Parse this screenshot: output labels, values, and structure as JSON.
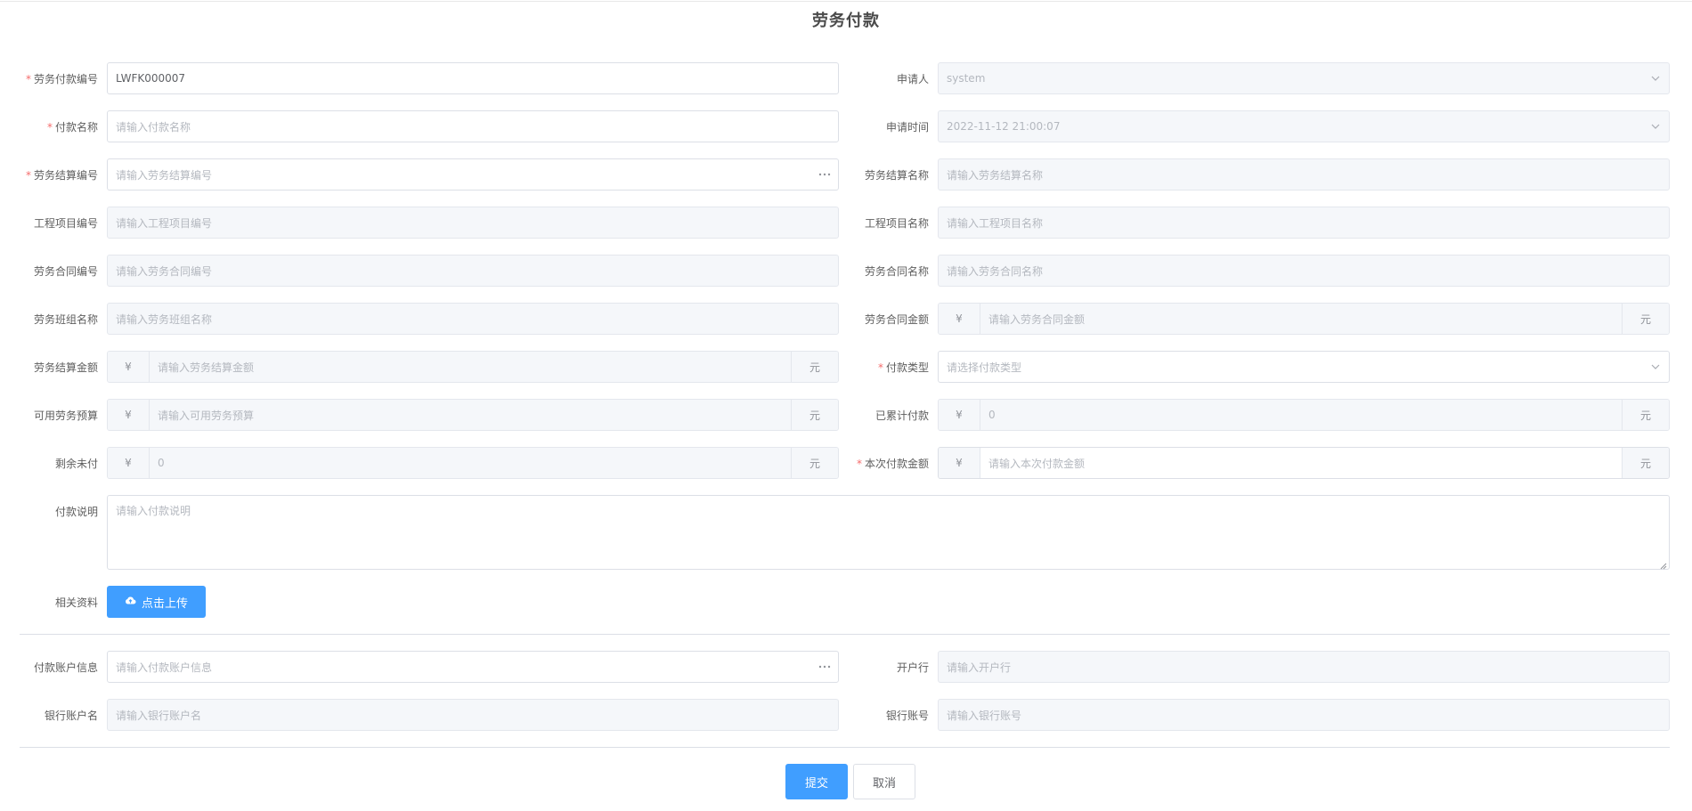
{
  "page": {
    "title": "劳务付款"
  },
  "icons": {
    "ellipsis": "ellipsis-icon",
    "chevron": "chevron-down-icon",
    "upload": "cloud-upload-icon"
  },
  "currency": {
    "prefix": "¥",
    "suffix": "元"
  },
  "fields": {
    "payment_no": {
      "label": "劳务付款编号",
      "value": "LWFK000007"
    },
    "applicant": {
      "label": "申请人",
      "value": "system"
    },
    "payment_name": {
      "label": "付款名称",
      "placeholder": "请输入付款名称"
    },
    "apply_time": {
      "label": "申请时间",
      "value": "2022-11-12 21:00:07"
    },
    "settlement_no": {
      "label": "劳务结算编号",
      "placeholder": "请输入劳务结算编号"
    },
    "settlement_name": {
      "label": "劳务结算名称",
      "placeholder": "请输入劳务结算名称"
    },
    "project_no": {
      "label": "工程项目编号",
      "placeholder": "请输入工程项目编号"
    },
    "project_name": {
      "label": "工程项目名称",
      "placeholder": "请输入工程项目名称"
    },
    "contract_no": {
      "label": "劳务合同编号",
      "placeholder": "请输入劳务合同编号"
    },
    "contract_name": {
      "label": "劳务合同名称",
      "placeholder": "请输入劳务合同名称"
    },
    "team_name": {
      "label": "劳务班组名称",
      "placeholder": "请输入劳务班组名称"
    },
    "contract_amount": {
      "label": "劳务合同金额",
      "placeholder": "请输入劳务合同金额"
    },
    "settlement_amount": {
      "label": "劳务结算金额",
      "placeholder": "请输入劳务结算金额"
    },
    "payment_type": {
      "label": "付款类型",
      "placeholder": "请选择付款类型"
    },
    "available_budget": {
      "label": "可用劳务预算",
      "placeholder": "请输入可用劳务预算"
    },
    "paid_total": {
      "label": "已累计付款",
      "value": "0"
    },
    "remaining_unpaid": {
      "label": "剩余未付",
      "value": "0"
    },
    "current_amount": {
      "label": "本次付款金额",
      "placeholder": "请输入本次付款金额"
    },
    "payment_desc": {
      "label": "付款说明",
      "placeholder": "请输入付款说明"
    },
    "attachments": {
      "label": "相关资料",
      "button": "点击上传"
    },
    "account_info": {
      "label": "付款账户信息",
      "placeholder": "请输入付款账户信息"
    },
    "bank": {
      "label": "开户行",
      "placeholder": "请输入开户行"
    },
    "account_name": {
      "label": "银行账户名",
      "placeholder": "请输入银行账户名"
    },
    "account_no": {
      "label": "银行账号",
      "placeholder": "请输入银行账号"
    }
  },
  "actions": {
    "submit": "提交",
    "cancel": "取消"
  }
}
